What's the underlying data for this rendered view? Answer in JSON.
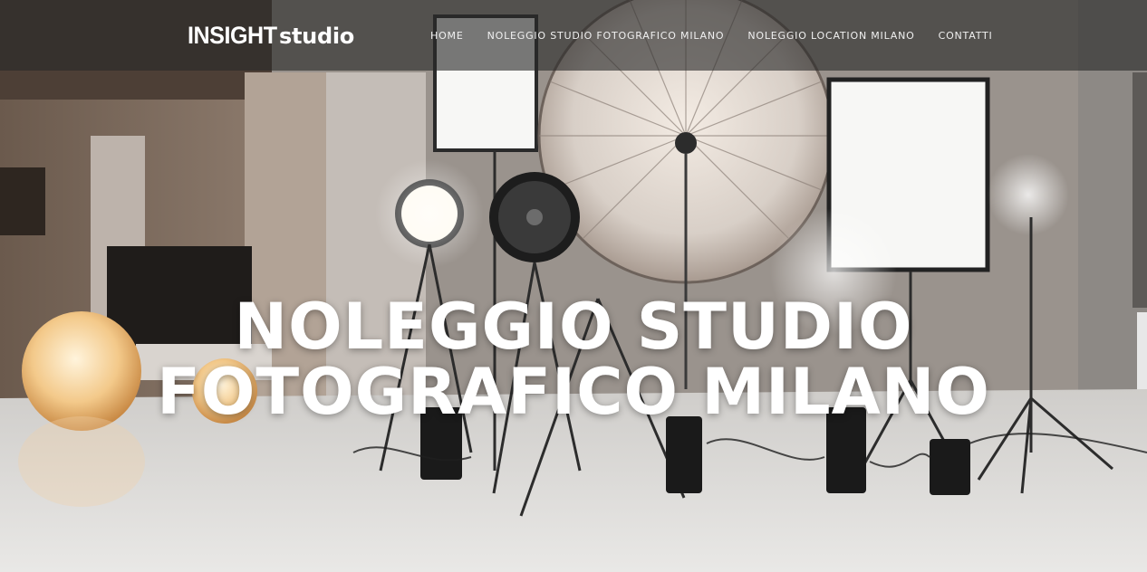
{
  "header": {
    "logo": {
      "strong": "INSIGHT",
      "light": "studio"
    },
    "nav": [
      {
        "label": "HOME"
      },
      {
        "label": "NOLEGGIO STUDIO FOTOGRAFICO MILANO"
      },
      {
        "label": "NOLEGGIO LOCATION MILANO"
      },
      {
        "label": "CONTATTI"
      }
    ]
  },
  "hero": {
    "title_line1": "NOLEGGIO STUDIO",
    "title_line2": "FOTOGRAFICO MILANO",
    "image": "photo studio with umbrella light, softboxes, fan and spotlights",
    "colors": {
      "overlay": "#282828",
      "text": "#ffffff"
    }
  }
}
